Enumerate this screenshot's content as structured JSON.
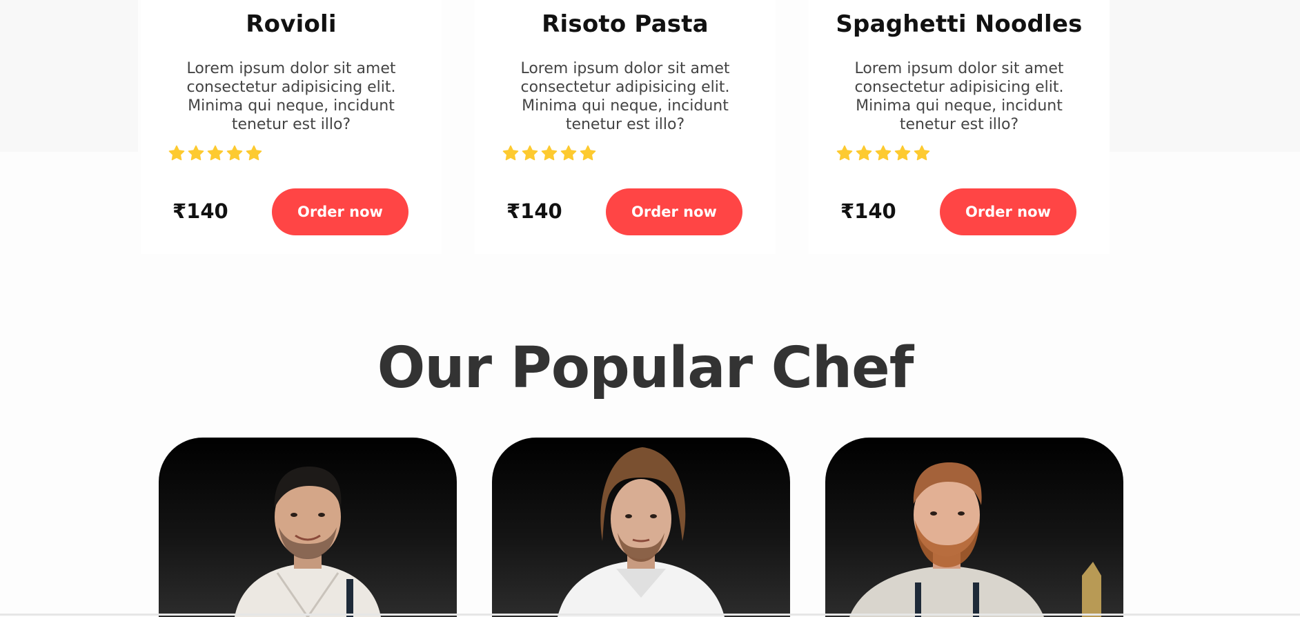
{
  "dishes": [
    {
      "name": "Rovioli",
      "description": "Lorem ipsum dolor sit amet consectetur adipisicing elit. Minima qui neque, incidunt tenetur est illo?",
      "rating": 5,
      "price": "₹140",
      "order_label": "Order now"
    },
    {
      "name": "Risoto Pasta",
      "description": "Lorem ipsum dolor sit amet consectetur adipisicing elit. Minima qui neque, incidunt tenetur est illo?",
      "rating": 5,
      "price": "₹140",
      "order_label": "Order now"
    },
    {
      "name": "Spaghetti Noodles",
      "description": "Lorem ipsum dolor sit amet consectetur adipisicing elit. Minima qui neque, incidunt tenetur est illo?",
      "rating": 5,
      "price": "₹140",
      "order_label": "Order now"
    }
  ],
  "chefs_section": {
    "title": "Our Popular Chef"
  },
  "colors": {
    "accent": "#ff4545",
    "star": "#fdca30",
    "title": "#333333"
  },
  "icons": {
    "rating": "star-icon"
  }
}
